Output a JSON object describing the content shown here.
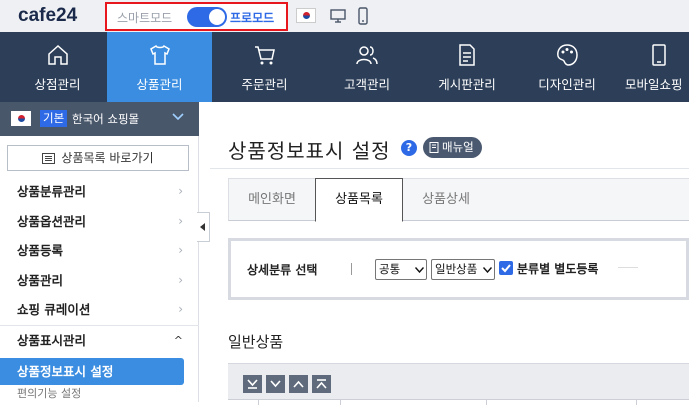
{
  "topbar": {
    "logo": "cafe24",
    "mode_smart": "스마트모드",
    "mode_pro": "프로모드"
  },
  "nav": {
    "items": [
      {
        "label": "상점관리",
        "icon": "home-icon"
      },
      {
        "label": "상품관리",
        "icon": "shirt-icon",
        "active": true
      },
      {
        "label": "주문관리",
        "icon": "cart-icon"
      },
      {
        "label": "고객관리",
        "icon": "users-icon"
      },
      {
        "label": "게시판관리",
        "icon": "board-icon"
      },
      {
        "label": "디자인관리",
        "icon": "palette-icon"
      },
      {
        "label": "모바일쇼핑",
        "icon": "mobile-icon"
      }
    ],
    "colors": {
      "bar": "#2c3e58",
      "active": "#3a8de0"
    }
  },
  "sidebar": {
    "shop_badge": "기본",
    "shop_name": "한국어 쇼핑몰",
    "goto_button": "상품목록 바로가기",
    "menu": [
      {
        "label": "상품분류관리"
      },
      {
        "label": "상품옵션관리"
      },
      {
        "label": "상품등록"
      },
      {
        "label": "상품관리"
      },
      {
        "label": "쇼핑 큐레이션"
      },
      {
        "label": "상품표시관리"
      }
    ],
    "selected_item": "상품정보표시 설정",
    "sub_item": "편의기능 설정"
  },
  "content": {
    "title": "상품정보표시 설정",
    "help": "?",
    "manual_button": "매뉴얼",
    "tabs": [
      {
        "label": "메인화면"
      },
      {
        "label": "상품목록",
        "active": true
      },
      {
        "label": "상품상세"
      }
    ],
    "filter": {
      "label": "상세분류 선택",
      "select1": "공통",
      "select2": "일반상품",
      "checkbox_label": "분류별 별도등록",
      "checkbox_checked": true
    },
    "section_title": "일반상품"
  }
}
